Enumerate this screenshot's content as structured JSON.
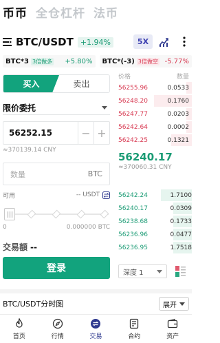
{
  "top_tabs": [
    "币币",
    "全仓杠杆",
    "法币"
  ],
  "pair": {
    "name": "BTC/USDT",
    "change": "+1.94%",
    "leverage": "5X"
  },
  "chips": [
    {
      "name": "BTC*3",
      "tag": "3倍做多",
      "value": "+5.80%"
    },
    {
      "name": "BTC*(-3)",
      "tag": "3倍做空",
      "value": "-5.77%"
    }
  ],
  "trade": {
    "buy_label": "买入",
    "sell_label": "卖出",
    "order_type": "限价委托",
    "price": "56252.15",
    "price_cny": "≈370139.14 CNY",
    "qty_placeholder": "数量",
    "qty_unit": "BTC",
    "avail_label": "可用",
    "avail_value": "-- USDT",
    "slider_value_percent": 0,
    "slider_min": "0",
    "slider_max": "0.000000 BTC",
    "turnover_label": "交易額",
    "turnover_value": "--",
    "submit_label": "登录"
  },
  "orderbook": {
    "price_header": "价格",
    "qty_header": "数量",
    "asks": [
      {
        "price": "56255.96",
        "qty": "0.0533"
      },
      {
        "price": "56248.20",
        "qty": "0.1760"
      },
      {
        "price": "56247.77",
        "qty": "0.0203"
      },
      {
        "price": "56242.64",
        "qty": "0.0002"
      },
      {
        "price": "56242.25",
        "qty": "0.1321"
      }
    ],
    "mid_price": "56240.17",
    "mid_cny": "≈370060.31 CNY",
    "bids": [
      {
        "price": "56242.24",
        "qty": "1.7100",
        "depth": 1.0
      },
      {
        "price": "56240.17",
        "qty": "0.0309",
        "depth": 0.6
      },
      {
        "price": "56238.68",
        "qty": "0.1733",
        "depth": 0.6
      },
      {
        "price": "56236.96",
        "qty": "0.0477",
        "depth": 0.6
      },
      {
        "price": "56236.95",
        "qty": "1.7518",
        "depth": 0.6
      }
    ],
    "depth_label": "深度 1"
  },
  "timechart": {
    "title": "BTC/USDT分时图",
    "expand_label": "展开"
  },
  "nav": [
    {
      "label": "首页",
      "icon": "flame-icon"
    },
    {
      "label": "行情",
      "icon": "compass-icon"
    },
    {
      "label": "交易",
      "icon": "trade-icon"
    },
    {
      "label": "合约",
      "icon": "contract-icon"
    },
    {
      "label": "资产",
      "icon": "wallet-icon"
    }
  ],
  "colors": {
    "green": "#12a37d",
    "red": "#d83a52",
    "accent": "#2f3a8f"
  }
}
